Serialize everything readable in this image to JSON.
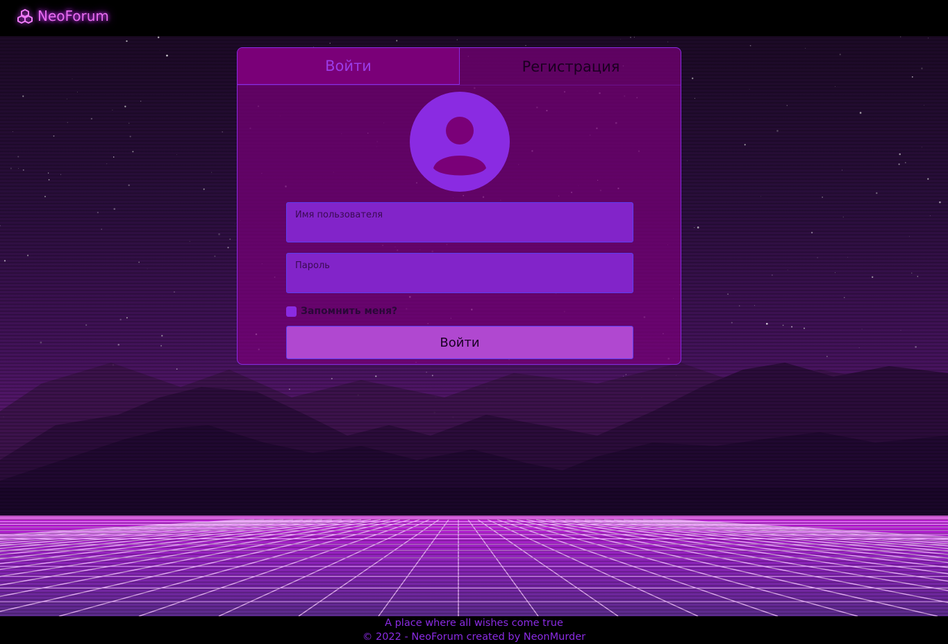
{
  "brand": {
    "name": "NeoForum",
    "icon": "cubes-icon"
  },
  "tabs": [
    {
      "label": "Войти",
      "active": true
    },
    {
      "label": "Регистрация",
      "active": false
    }
  ],
  "form": {
    "avatar_icon": "user-circle-icon",
    "username": {
      "label": "Имя пользователя",
      "value": ""
    },
    "password": {
      "label": "Пароль",
      "value": ""
    },
    "remember_label": "Запомнить меня?",
    "submit_label": "Войти"
  },
  "footer": {
    "tagline": "A place where all wishes come true",
    "copyright": "© 2022 - NeoForum created by NeonMurder"
  },
  "colors": {
    "accent": "#8a2be2",
    "brand_glow": "#e86cf0",
    "card_bg": "#780078",
    "field_bg": "#8224c9",
    "button_bg": "#b048d0"
  }
}
